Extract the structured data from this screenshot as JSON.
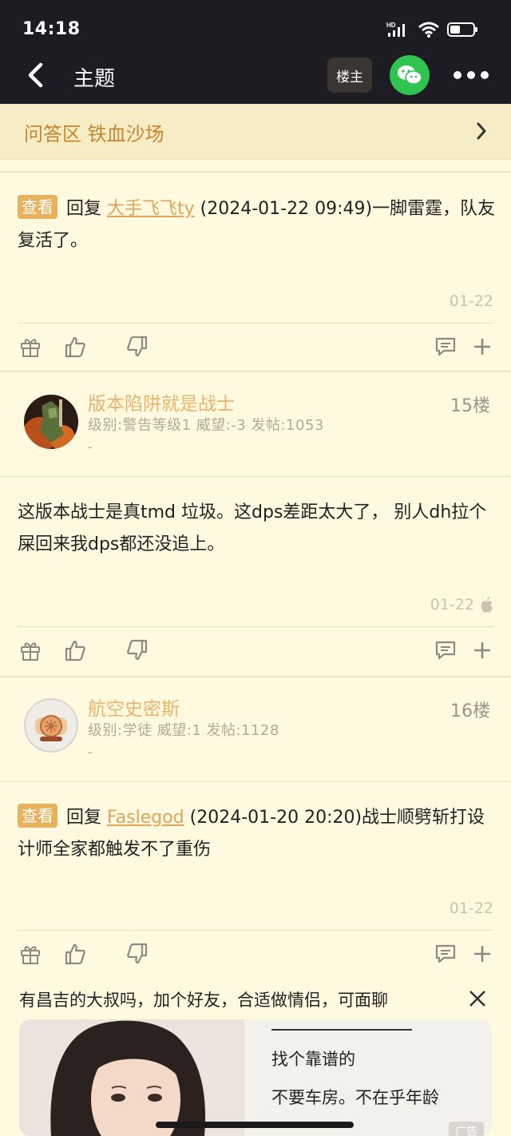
{
  "status": {
    "time": "14:18",
    "network": "HD"
  },
  "nav": {
    "title": "主题",
    "owner_label": "楼主"
  },
  "forum": {
    "name": "问答区 铁血沙场"
  },
  "posts": [
    {
      "tag": "查看",
      "reply_prefix": "回复",
      "reply_user": "大手飞飞ty",
      "reply_suffix": "(2024-01-22 09:49)一脚雷霆，队友复活了。",
      "date": "01-22"
    },
    {
      "username": "版本陷阱就是战士",
      "meta": "级别:警告等级1 威望:-3 发帖:1053",
      "dash": "-",
      "floor": "15楼",
      "content": "这版本战士是真tmd 垃圾。这dps差距太大了，  别人dh拉个屎回来我dps都还没追上。",
      "date": "01-22"
    },
    {
      "username": "航空史密斯",
      "meta": "级别:学徒 威望:1 发帖:1128",
      "dash": "-",
      "floor": "16楼",
      "tag": "查看",
      "reply_prefix": "回复",
      "reply_user": "Faslegod",
      "reply_suffix": "(2024-01-20 20:20)战士顺劈斩打设计师全家都触发不了重伤",
      "date": "01-22"
    }
  ],
  "ad": {
    "headline": "有昌吉的大叔吗，加个好友，合适做情侣，可面聊",
    "line1": "找个靠谱的",
    "line2": "不要车房。不在乎年龄",
    "badge": "广告"
  },
  "colors": {
    "accent": "#e0a55a",
    "header_bg": "#1c1c22",
    "page_bg": "#fff9e0",
    "wechat": "#2fc34f"
  }
}
